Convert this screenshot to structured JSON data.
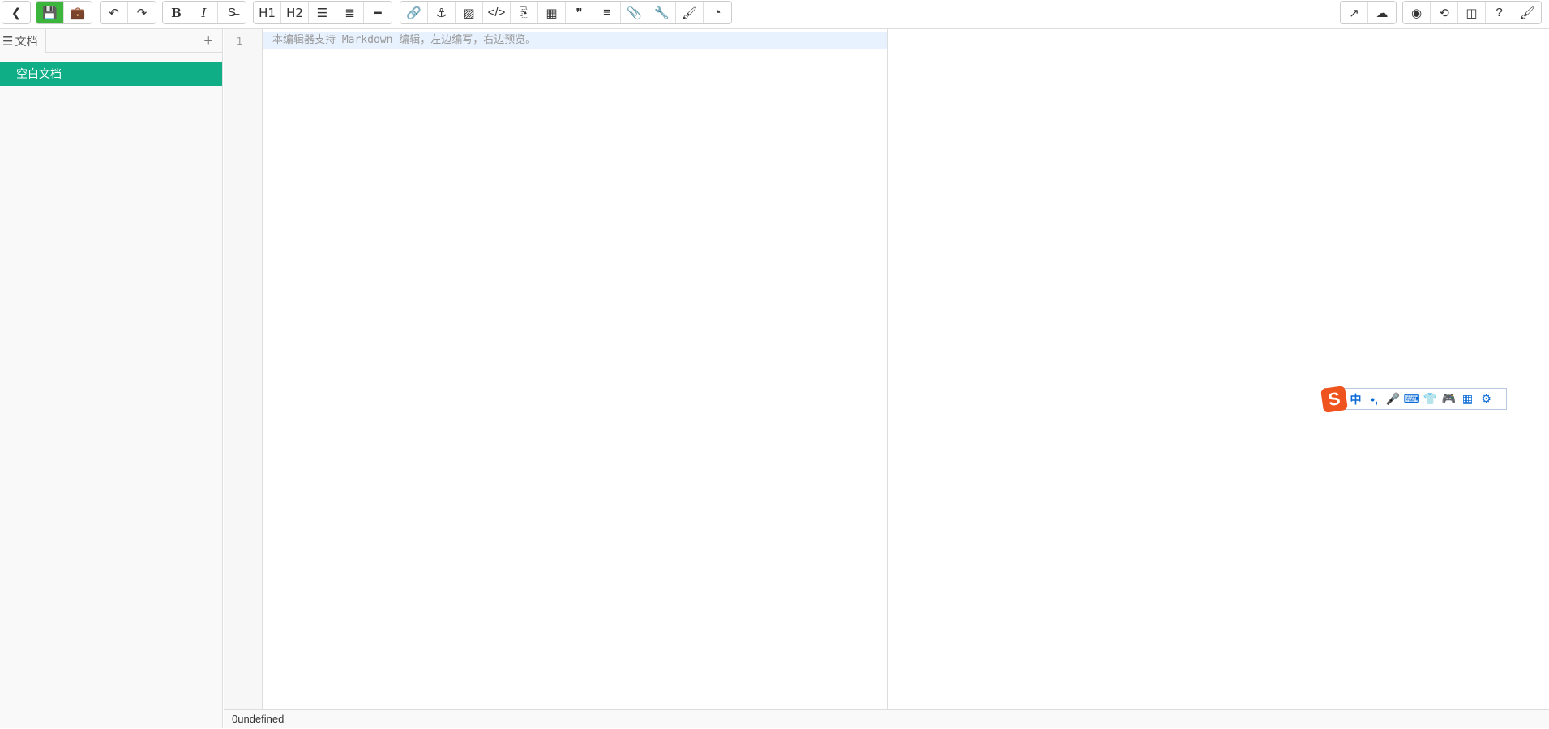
{
  "toolbar": {
    "left": [
      [
        {
          "name": "back",
          "icon": "❮"
        }
      ],
      [
        {
          "name": "save",
          "icon": "💾"
        },
        {
          "name": "briefcase",
          "icon": "💼"
        }
      ],
      [
        {
          "name": "undo",
          "icon": "↶"
        },
        {
          "name": "redo",
          "icon": "↷"
        }
      ],
      [
        {
          "name": "bold",
          "icon": "B"
        },
        {
          "name": "italic",
          "icon": "I"
        },
        {
          "name": "strikethrough",
          "icon": "S̶"
        }
      ],
      [
        {
          "name": "h1",
          "icon": "H1"
        },
        {
          "name": "h2",
          "icon": "H2"
        },
        {
          "name": "unordered-list",
          "icon": "☰"
        },
        {
          "name": "ordered-list",
          "icon": "≣"
        },
        {
          "name": "horizontal-rule",
          "icon": "━"
        }
      ],
      [
        {
          "name": "link",
          "icon": "🔗"
        },
        {
          "name": "anchor",
          "icon": "⚓"
        },
        {
          "name": "image",
          "icon": "▨"
        },
        {
          "name": "code",
          "icon": "</>"
        },
        {
          "name": "code-block",
          "icon": "⎘"
        },
        {
          "name": "table",
          "icon": "▦"
        },
        {
          "name": "quote",
          "icon": "❞"
        },
        {
          "name": "template",
          "icon": "≡"
        },
        {
          "name": "attachment",
          "icon": "📎"
        },
        {
          "name": "wrench",
          "icon": "🔧"
        },
        {
          "name": "brush",
          "icon": "🖌"
        },
        {
          "name": "dashboard",
          "icon": "◔"
        }
      ]
    ],
    "right": [
      [
        {
          "name": "external-link",
          "icon": "↗"
        },
        {
          "name": "cloud-upload",
          "icon": "☁"
        }
      ],
      [
        {
          "name": "eye-slash",
          "icon": "◉"
        },
        {
          "name": "history",
          "icon": "⟲"
        },
        {
          "name": "columns",
          "icon": "◫"
        },
        {
          "name": "help",
          "icon": "?"
        },
        {
          "name": "theme-brush",
          "icon": "🖌"
        }
      ]
    ]
  },
  "sidebar": {
    "tab_label": "文档",
    "add": "+",
    "items": [
      {
        "label": "空白文档"
      }
    ]
  },
  "editor": {
    "line_number": "1",
    "placeholder": "本编辑器支持 Markdown 编辑，左边编写，右边预览。"
  },
  "status": {
    "text": "0undefined"
  },
  "ime": {
    "logo": "S",
    "items": [
      "中",
      "•,",
      "🎤",
      "⌨",
      "👕",
      "🎮",
      "▦",
      "⚙"
    ]
  }
}
